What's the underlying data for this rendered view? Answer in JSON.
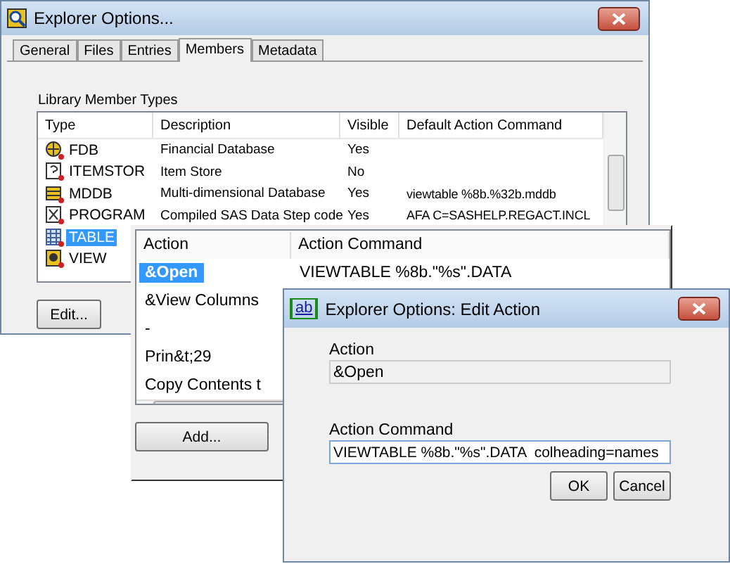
{
  "main_window": {
    "title": "Explorer Options...",
    "tabs": [
      {
        "label": "General",
        "selected": false
      },
      {
        "label": "Files",
        "selected": false
      },
      {
        "label": "Entries",
        "selected": false
      },
      {
        "label": "Members",
        "selected": true
      },
      {
        "label": "Metadata",
        "selected": false
      }
    ],
    "group_label": "Library Member Types",
    "columns": [
      "Type",
      "Description",
      "Visible",
      "Default Action Command"
    ],
    "rows": [
      {
        "type": "FDB",
        "description": "Financial Database",
        "visible": "Yes",
        "selected": false
      },
      {
        "type": "ITEMSTOR",
        "description": "Item Store",
        "visible": "No",
        "selected": false
      },
      {
        "type": "MDDB",
        "description": "Multi-dimensional Database",
        "visible": "Yes",
        "command": "viewtable %8b.%32b.mddb",
        "selected": false
      },
      {
        "type": "PROGRAM",
        "description": "Compiled SAS Data Step code",
        "visible": "Yes",
        "command": "AFA C=SASHELP.REGACT.INCL",
        "selected": false
      },
      {
        "type": "TABLE",
        "selected": true
      },
      {
        "type": "VIEW",
        "selected": false
      }
    ],
    "edit_button": "Edit..."
  },
  "action_panel": {
    "columns": [
      "Action",
      "Action Command"
    ],
    "rows": [
      {
        "action": "&Open",
        "command": "VIEWTABLE %8b.\"%s\".DATA",
        "selected": true
      },
      {
        "action": "&View Columns",
        "selected": false
      },
      {
        "action": "-",
        "selected": false
      },
      {
        "action": "Prin&t;29",
        "selected": false
      },
      {
        "action": "Copy Contents t",
        "selected": false
      }
    ],
    "add_button": "Add..."
  },
  "edit_dialog": {
    "title": "Explorer Options: Edit Action",
    "icon_text": "ab",
    "action_label": "Action",
    "action_value": "&Open",
    "command_label": "Action Command",
    "command_value": "VIEWTABLE %8b.\"%s\".DATA  colheading=names",
    "buttons": [
      "OK",
      "Cancel"
    ]
  }
}
